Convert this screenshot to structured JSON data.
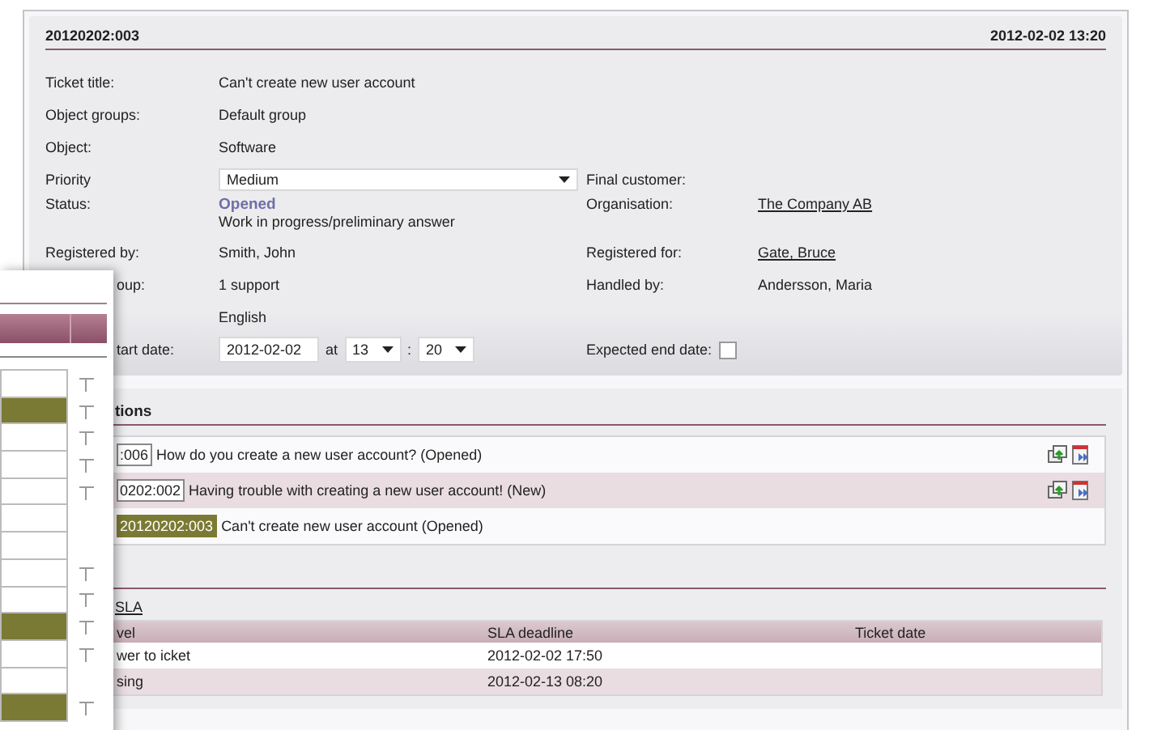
{
  "ticket": {
    "id": "20120202:003",
    "timestamp": "2012-02-02 13:20"
  },
  "rows": [
    {
      "label": "Ticket title:",
      "kind": "text",
      "value": "Can't create new user account"
    },
    {
      "label": "Object groups:",
      "kind": "text",
      "value": "Default group"
    },
    {
      "label": "Object:",
      "kind": "text",
      "value": "Software"
    },
    {
      "label": "Priority",
      "kind": "select",
      "value": "Medium",
      "right": {
        "label": "Final customer:",
        "kind": "empty"
      }
    },
    {
      "label": "Status:",
      "kind": "status",
      "value": "Opened",
      "note": "Work in progress/preliminary answer",
      "right": {
        "label": "Organisation:",
        "kind": "link",
        "value": "The Company AB"
      }
    },
    {
      "label": "Registered by:",
      "kind": "text",
      "value": "Smith, John",
      "right": {
        "label": "Registered for:",
        "kind": "link",
        "value": "Gate, Bruce"
      }
    },
    {
      "label": "oup:",
      "partial": true,
      "kind": "text",
      "value": "1 support",
      "right": {
        "label": "Handled by:",
        "kind": "text",
        "value": "Andersson, Maria"
      }
    },
    {
      "kind": "text",
      "value": "English"
    },
    {
      "label": "tart date:",
      "partial": true,
      "kind": "datetime",
      "date": "2012-02-02",
      "at": "at",
      "hour": "13",
      "sep": ":",
      "minute": "20",
      "right": {
        "label": "Expected end date:",
        "kind": "checkbox",
        "checked": false
      }
    }
  ],
  "relations": {
    "title": "tions",
    "rows": [
      {
        "id": ":006",
        "text": "How do you create a new user account? (Opened)",
        "current": false,
        "actions": true
      },
      {
        "id": "0202:002",
        "text": "Having trouble with creating a new user account! (New)",
        "current": false,
        "actions": true
      },
      {
        "id": "20120202:003",
        "text": "Can't create new user account (Opened)",
        "current": true,
        "actions": false
      }
    ]
  },
  "sla": {
    "link": "SLA",
    "columns": [
      "vel",
      "SLA deadline",
      "Ticket date"
    ],
    "rows": [
      {
        "level": "wer to icket",
        "deadline": "2012-02-02 17:50"
      },
      {
        "level": "sing",
        "deadline": "2012-02-13 08:20"
      }
    ]
  },
  "overlay": {
    "rows": [
      {
        "highlighted": false,
        "marked": true
      },
      {
        "highlighted": true,
        "marked": true
      },
      {
        "highlighted": false,
        "marked": true
      },
      {
        "highlighted": false,
        "marked": true
      },
      {
        "highlighted": false,
        "marked": true
      },
      {
        "highlighted": false,
        "marked": false
      },
      {
        "highlighted": false,
        "marked": false
      },
      {
        "highlighted": false,
        "marked": true
      },
      {
        "highlighted": false,
        "marked": true
      },
      {
        "highlighted": true,
        "marked": true
      },
      {
        "highlighted": false,
        "marked": true
      },
      {
        "highlighted": false,
        "marked": false
      },
      {
        "highlighted": true,
        "marked": true
      }
    ]
  }
}
